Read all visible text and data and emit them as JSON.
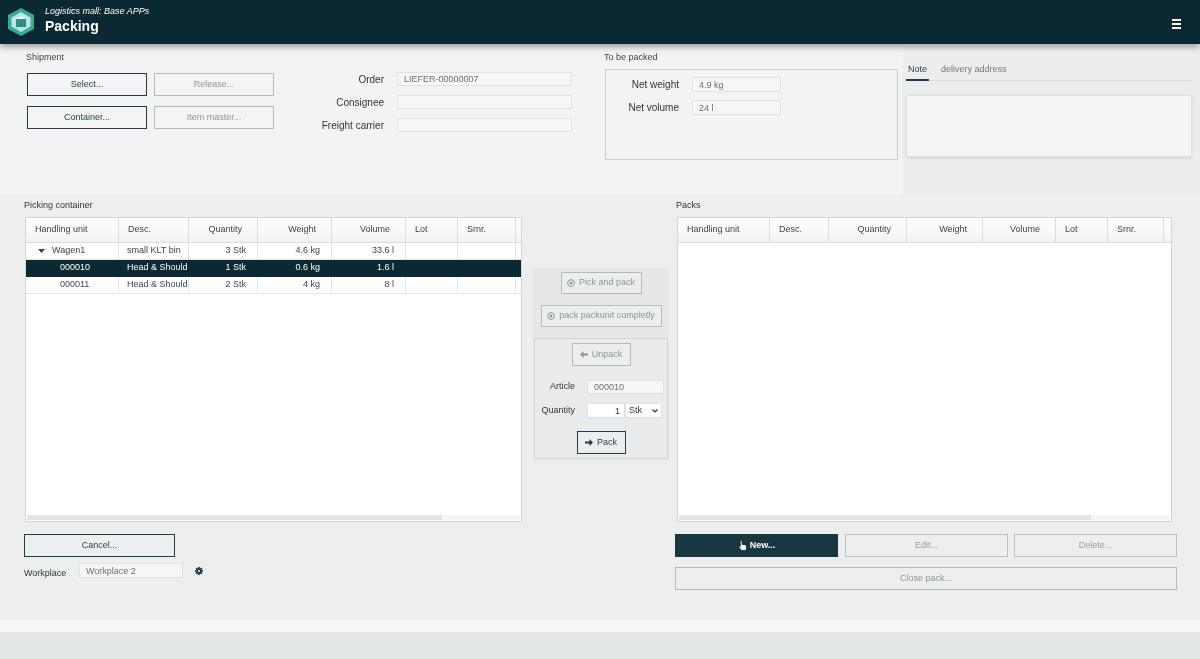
{
  "app": {
    "subtitle": "Logistics mall: Base APPs",
    "title": "Packing"
  },
  "shipment": {
    "label": "Shipment",
    "buttons": [
      {
        "label": "Select...",
        "disabled": false
      },
      {
        "label": "Release...",
        "disabled": true
      },
      {
        "label": "Container...",
        "disabled": false
      },
      {
        "label": "Item master...",
        "disabled": true
      }
    ],
    "fields": [
      {
        "label": "Order",
        "value": "LIEFER-00000007"
      },
      {
        "label": "Consignee"
      },
      {
        "label": "Freight carrier"
      }
    ]
  },
  "to_be_packed": {
    "label": "To be packed",
    "fields": [
      {
        "label": "Net weight",
        "value": "4.9 kg"
      },
      {
        "label": "Net volume",
        "value": "24 l"
      }
    ]
  },
  "info_tabs": [
    {
      "label": "Note",
      "selected": true
    },
    {
      "label": "delivery address",
      "selected": false
    }
  ],
  "picking_container": {
    "label": "Picking container",
    "columns": [
      "Handling unit",
      "Desc.",
      "Quantity",
      "Weight",
      "Volume",
      "Lot",
      "Srnr."
    ],
    "rows": [
      {
        "handling_unit": "Wagen1",
        "desc": "small KLT bin",
        "quantity": "3 Stk",
        "weight": "4.6 kg",
        "volume": "33.6 l",
        "expanded": true,
        "selected": false,
        "children": [
          {
            "handling_unit": "000010",
            "desc": "Head & Should",
            "quantity": "1 Stk",
            "weight": "0.6 kg",
            "volume": "1.6 l",
            "selected": true
          },
          {
            "handling_unit": "000011",
            "desc": "Head & Should",
            "quantity": "2 Stk",
            "weight": "4 kg",
            "volume": "8 l",
            "selected": false
          }
        ]
      }
    ]
  },
  "transfer": {
    "buttons": [
      {
        "label": "Pick and pack",
        "disabled": true
      },
      {
        "label": "pack packunit completly",
        "disabled": true
      }
    ],
    "unpack_button": {
      "label": "Unpack",
      "disabled": true
    },
    "article": {
      "label": "Article",
      "value": "000010"
    },
    "quantity": {
      "label": "Quantity",
      "value": "1",
      "unit": "Stk"
    },
    "pack_button": {
      "label": "Pack",
      "disabled": false
    }
  },
  "packs": {
    "label": "Packs",
    "columns": [
      "Handling unit",
      "Desc.",
      "Quantity",
      "Weight",
      "Volume",
      "Lot",
      "Srnr."
    ]
  },
  "cancel_button": {
    "label": "Cancel...",
    "disabled": false
  },
  "workplace": {
    "label": "Workplace",
    "value": "Workplace 2"
  },
  "pack_actions": [
    {
      "label": "New...",
      "kind": "primary",
      "disabled": false
    },
    {
      "label": "Edit...",
      "kind": "default",
      "disabled": true
    },
    {
      "label": "Delete...",
      "kind": "default",
      "disabled": true
    }
  ],
  "close_pack_button": {
    "label": "Close pack...",
    "disabled": true
  }
}
